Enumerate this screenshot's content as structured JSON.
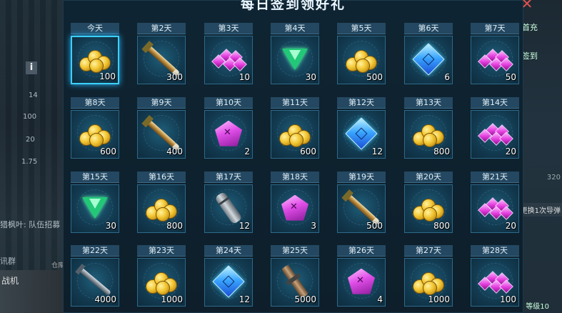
{
  "dialog": {
    "title": "每日签到领好礼"
  },
  "hud": {
    "numbers": [
      "14",
      "100",
      "20",
      "1.75"
    ],
    "chat_text": "猎枫叶: 队伍招募",
    "team_label": "讯群",
    "warehouse_label": "仓库",
    "plane_label": "战机",
    "right_number": "320",
    "right_button": "更换1次导弹",
    "right_labels": [
      "首充",
      "签到",
      "等级10"
    ]
  },
  "rewards": [
    {
      "day": "今天",
      "item": "gold-coin",
      "qty": "100",
      "active": true
    },
    {
      "day": "第2天",
      "item": "rocket",
      "qty": "300"
    },
    {
      "day": "第3天",
      "item": "pink-gems",
      "qty": "10"
    },
    {
      "day": "第4天",
      "item": "emerald",
      "qty": "30"
    },
    {
      "day": "第5天",
      "item": "gold-coin",
      "qty": "500"
    },
    {
      "day": "第6天",
      "item": "blue-crystal",
      "qty": "6"
    },
    {
      "day": "第7天",
      "item": "pink-gems",
      "qty": "50"
    },
    {
      "day": "第8天",
      "item": "gold-coin",
      "qty": "600"
    },
    {
      "day": "第9天",
      "item": "rocket",
      "qty": "400"
    },
    {
      "day": "第10天",
      "item": "purple-crystal",
      "qty": "2"
    },
    {
      "day": "第11天",
      "item": "gold-coin",
      "qty": "600"
    },
    {
      "day": "第12天",
      "item": "blue-crystal",
      "qty": "12"
    },
    {
      "day": "第13天",
      "item": "gold-coin",
      "qty": "800"
    },
    {
      "day": "第14天",
      "item": "pink-gems",
      "qty": "20"
    },
    {
      "day": "第15天",
      "item": "emerald",
      "qty": "30"
    },
    {
      "day": "第16天",
      "item": "gold-coin",
      "qty": "800"
    },
    {
      "day": "第17天",
      "item": "canister",
      "qty": "12"
    },
    {
      "day": "第18天",
      "item": "purple-crystal",
      "qty": "3"
    },
    {
      "day": "第19天",
      "item": "rocket",
      "qty": "500"
    },
    {
      "day": "第20天",
      "item": "gold-coin",
      "qty": "800"
    },
    {
      "day": "第21天",
      "item": "pink-gems",
      "qty": "20"
    },
    {
      "day": "第22天",
      "item": "missile",
      "qty": "4000"
    },
    {
      "day": "第23天",
      "item": "gold-coin",
      "qty": "1000"
    },
    {
      "day": "第24天",
      "item": "blue-crystal",
      "qty": "12"
    },
    {
      "day": "第25天",
      "item": "launcher",
      "qty": "5000"
    },
    {
      "day": "第26天",
      "item": "purple-crystal",
      "qty": "4"
    },
    {
      "day": "第27天",
      "item": "gold-coin",
      "qty": "1000"
    },
    {
      "day": "第28天",
      "item": "pink-gems",
      "qty": "100"
    }
  ]
}
